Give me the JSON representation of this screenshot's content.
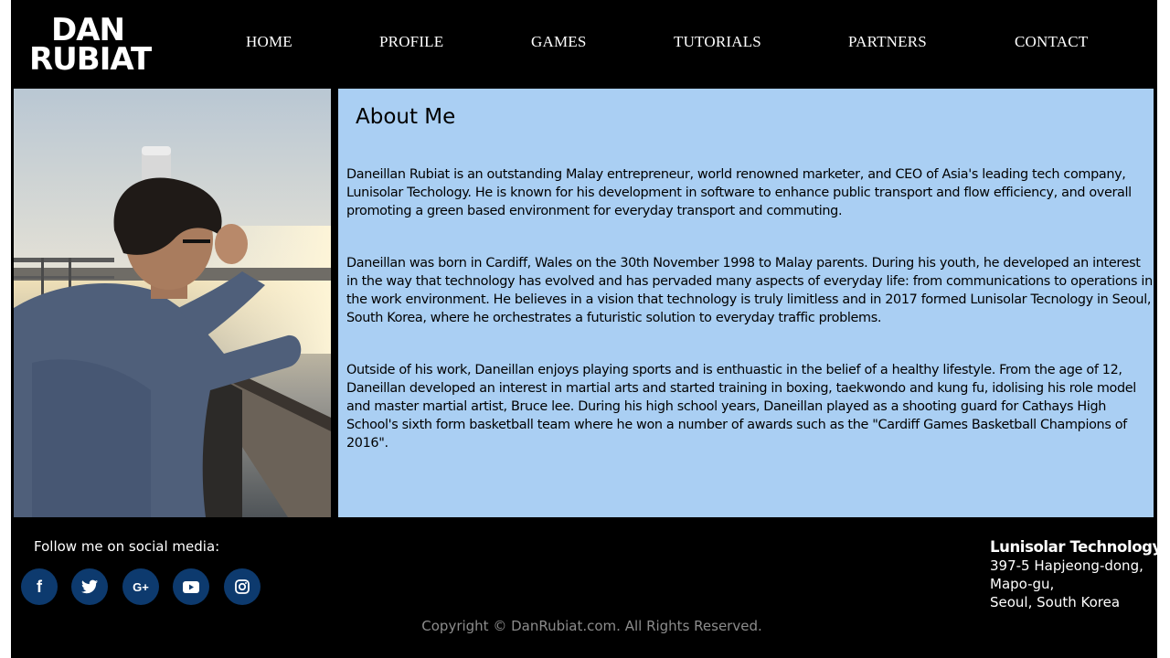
{
  "logo": {
    "line1": "DAN",
    "line2": "RUBIAT"
  },
  "nav": {
    "items": [
      {
        "label": "HOME"
      },
      {
        "label": "PROFILE"
      },
      {
        "label": "GAMES"
      },
      {
        "label": "TUTORIALS"
      },
      {
        "label": "PARTNERS"
      },
      {
        "label": "CONTACT"
      }
    ]
  },
  "about": {
    "title": "About Me",
    "paragraphs": [
      "Daneillan Rubiat is an outstanding Malay entrepreneur, world renowned marketer, and CEO of Asia's leading tech company, Lunisolar Techology. He is known for his development in software to enhance public transport and flow efficiency, and overall promoting a green based environment for everyday transport and commuting.",
      "Daneillan was born in Cardiff, Wales on the 30th November 1998 to Malay parents. During his youth, he developed an interest in the way that technology has evolved and has pervaded many aspects of everyday life: from communications to operations in the work environment. He believes in a vision that technology is truly limitless and in 2017 formed Lunisolar Tecnology in Seoul, South Korea, where he orchestrates a futuristic solution to everyday traffic problems.",
      "Outside of his work, Daneillan enjoys playing sports and is enthuastic in the belief of a healthy lifestyle. From the age of 12, Daneillan developed an interest in martial arts and started training in boxing, taekwondo and kung fu, idolising his role model and master martial artist, Bruce lee. During his high school years, Daneillan played as a shooting guard for Cathays High School's sixth form basketball team where he won a number of awards such as the \"Cardiff Games Basketball Champions of 2016\"."
    ]
  },
  "footer": {
    "follow_label": "Follow me on social media:",
    "social": [
      {
        "icon": "facebook-icon",
        "glyph": "f"
      },
      {
        "icon": "twitter-icon",
        "glyph": ""
      },
      {
        "icon": "google-plus-icon",
        "glyph": "G+"
      },
      {
        "icon": "youtube-icon",
        "glyph": ""
      },
      {
        "icon": "instagram-icon",
        "glyph": ""
      }
    ],
    "company": {
      "name": "Lunisolar Technology",
      "address_lines": [
        "397-5 Hapjeong-dong,",
        "Mapo-gu,",
        "Seoul, South Korea"
      ]
    },
    "copyright": "Copyright © DanRubiat.com. All Rights Reserved."
  },
  "colors": {
    "background": "#000000",
    "about_panel": "#aacff3",
    "social_button": "#0d3a6e",
    "copyright_text": "#8c8c8c"
  }
}
